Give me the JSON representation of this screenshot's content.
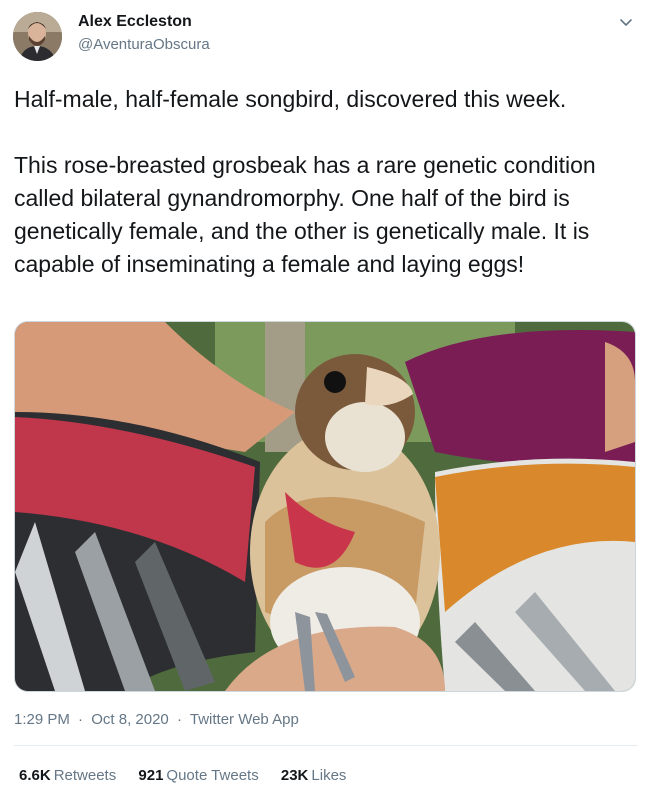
{
  "tweet": {
    "author": {
      "name": "Alex Eccleston",
      "handle": "@AventuraObscura"
    },
    "text": "Half-male, half-female songbird, discovered this week.\n\nThis rose-breasted grosbeak has a rare genetic condition called bilateral gynandromorphy. One half of the bird is genetically female, and the other is genetically male. It is capable of inseminating a female and laying eggs!",
    "timestamp": {
      "time": "1:29 PM",
      "date": "Oct 8, 2020",
      "separator": "·",
      "source": "Twitter Web App"
    },
    "stats": {
      "retweets": {
        "count": "6.6K",
        "label": "Retweets"
      },
      "quote_tweets": {
        "count": "921",
        "label": "Quote Tweets"
      },
      "likes": {
        "count": "23K",
        "label": "Likes"
      }
    },
    "icons": [
      "avatar-photo",
      "chevron-down-icon"
    ]
  },
  "colors": {
    "text_primary": "#14171a",
    "text_secondary": "#657786",
    "divider": "#e6ecf0"
  }
}
